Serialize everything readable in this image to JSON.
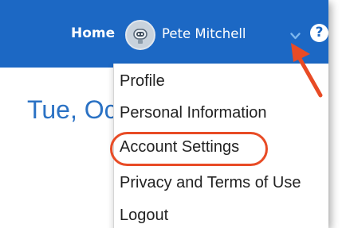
{
  "navbar": {
    "home_label": "Home",
    "user_name": "Pete Mitchell",
    "help_symbol": "?",
    "background_color": "#1c68c4"
  },
  "page": {
    "date_title": "Tue, Oc"
  },
  "dropdown": {
    "items": [
      {
        "label": "Profile"
      },
      {
        "label": "Personal Information"
      },
      {
        "label": "Account Settings"
      },
      {
        "label": "Privacy and Terms of Use"
      },
      {
        "label": "Logout"
      }
    ]
  },
  "annotation": {
    "highlight_color": "#e84b25",
    "highlighted_item": "Account Settings"
  },
  "icons": {
    "avatar": "robot-avatar-icon",
    "caret": "chevron-down-icon",
    "help": "help-circle-icon"
  }
}
